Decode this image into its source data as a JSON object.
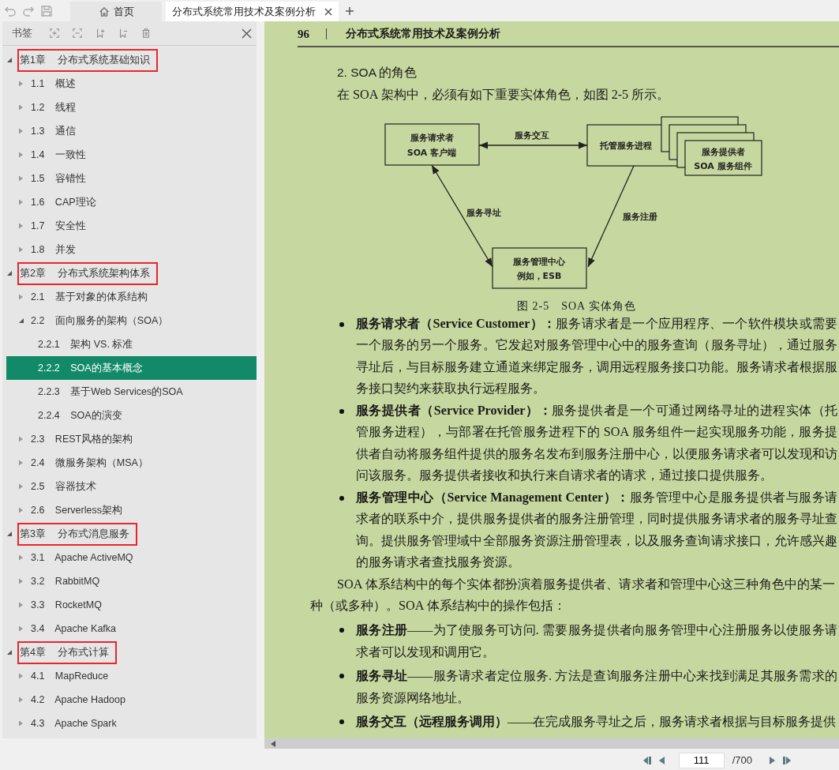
{
  "tabs": [
    {
      "label": "首页",
      "kind": "home",
      "selected": false
    },
    {
      "label": "分布式系统常用技术及案例分析",
      "kind": "document",
      "selected": true
    }
  ],
  "sidebar": {
    "title": "书签",
    "items": [
      {
        "number": "第1章",
        "label": "分布式系统基础知识",
        "expanded": true,
        "marked": true,
        "selected": false,
        "children": [
          {
            "number": "1.1",
            "label": "概述",
            "expanded": false,
            "marked": false,
            "selected": false
          },
          {
            "number": "1.2",
            "label": "线程",
            "expanded": false,
            "marked": false,
            "selected": false
          },
          {
            "number": "1.3",
            "label": "通信",
            "expanded": false,
            "marked": false,
            "selected": false
          },
          {
            "number": "1.4",
            "label": "一致性",
            "expanded": false,
            "marked": false,
            "selected": false
          },
          {
            "number": "1.5",
            "label": "容错性",
            "expanded": false,
            "marked": false,
            "selected": false
          },
          {
            "number": "1.6",
            "label": "CAP理论",
            "expanded": false,
            "marked": false,
            "selected": false
          },
          {
            "number": "1.7",
            "label": "安全性",
            "expanded": false,
            "marked": false,
            "selected": false
          },
          {
            "number": "1.8",
            "label": "并发",
            "expanded": false,
            "marked": false,
            "selected": false
          }
        ]
      },
      {
        "number": "第2章",
        "label": "分布式系统架构体系",
        "expanded": true,
        "marked": true,
        "selected": false,
        "children": [
          {
            "number": "2.1",
            "label": "基于对象的体系结构",
            "expanded": false,
            "marked": false,
            "selected": false
          },
          {
            "number": "2.2",
            "label": "面向服务的架构（SOA）",
            "expanded": true,
            "marked": false,
            "selected": false,
            "children": [
              {
                "number": "2.2.1",
                "label": "架构 VS. 标准",
                "marked": false,
                "selected": false
              },
              {
                "number": "2.2.2",
                "label": "SOA的基本概念",
                "marked": false,
                "selected": true
              },
              {
                "number": "2.2.3",
                "label": "基于Web Services的SOA",
                "marked": false,
                "selected": false
              },
              {
                "number": "2.2.4",
                "label": "SOA的演变",
                "marked": false,
                "selected": false
              }
            ]
          },
          {
            "number": "2.3",
            "label": "REST风格的架构",
            "expanded": false,
            "marked": false,
            "selected": false
          },
          {
            "number": "2.4",
            "label": "微服务架构（MSA）",
            "expanded": false,
            "marked": false,
            "selected": false
          },
          {
            "number": "2.5",
            "label": "容器技术",
            "expanded": false,
            "marked": false,
            "selected": false
          },
          {
            "number": "2.6",
            "label": "Serverless架构",
            "expanded": false,
            "marked": false,
            "selected": false
          }
        ]
      },
      {
        "number": "第3章",
        "label": "分布式消息服务",
        "expanded": true,
        "marked": true,
        "selected": false,
        "children": [
          {
            "number": "3.1",
            "label": "Apache ActiveMQ",
            "expanded": false,
            "marked": false,
            "selected": false
          },
          {
            "number": "3.2",
            "label": "RabbitMQ",
            "expanded": false,
            "marked": false,
            "selected": false
          },
          {
            "number": "3.3",
            "label": "RocketMQ",
            "expanded": false,
            "marked": false,
            "selected": false
          },
          {
            "number": "3.4",
            "label": "Apache Kafka",
            "expanded": false,
            "marked": false,
            "selected": false
          }
        ]
      },
      {
        "number": "第4章",
        "label": "分布式计算",
        "expanded": true,
        "marked": true,
        "selected": false,
        "children": [
          {
            "number": "4.1",
            "label": "MapReduce",
            "expanded": false,
            "marked": false,
            "selected": false
          },
          {
            "number": "4.2",
            "label": "Apache Hadoop",
            "expanded": false,
            "marked": false,
            "selected": false
          },
          {
            "number": "4.3",
            "label": "Apache Spark",
            "expanded": false,
            "marked": false,
            "selected": false
          }
        ]
      }
    ]
  },
  "page": {
    "page_number": "96",
    "running_title": "分布式系统常用技术及案例分析",
    "heading": "2. SOA 的角色",
    "intro": "在 SOA 架构中，必须有如下重要实体角色，如图 2-5 所示。",
    "figure": {
      "nodes": [
        {
          "kind": "requester",
          "lines": [
            "服务请求者",
            "SOA 客户端"
          ]
        },
        {
          "kind": "host",
          "lines": [
            "托管服务进程"
          ]
        },
        {
          "kind": "provider",
          "lines": [
            "服务提供者",
            "SOA 服务组件"
          ]
        },
        {
          "kind": "registry",
          "lines": [
            "服务管理中心",
            "例如，ESB"
          ]
        }
      ],
      "edges": [
        {
          "kind": "interact",
          "label": "服务交互"
        },
        {
          "kind": "discover",
          "label": "服务寻址"
        },
        {
          "kind": "register",
          "label": "服务注册"
        }
      ],
      "caption": "图 2-5　SOA 实体角色"
    },
    "roles": [
      "**服务请求者（Service Customer）：**服务请求者是一个应用程序、一个软件模块或需要一个服务的另一个服务。它发起对服务管理中心中的服务查询（服务寻址），通过服务寻址后，与目标服务建立通道来绑定服务，调用远程服务接口功能。服务请求者根据服务接口契约来获取执行远程服务。",
      "**服务提供者（Service Provider）：**服务提供者是一个可通过网络寻址的进程实体（托管服务进程），与部署在托管服务进程下的 SOA 服务组件一起实现服务功能，服务提供者自动将服务组件提供的服务名发布到服务注册中心，以便服务请求者可以发现和访问该服务。服务提供者接收和执行来自请求者的请求，通过接口提供服务。",
      "**服务管理中心（Service Management Center）：**服务管理中心是服务提供者与服务请求者的联系中介，提供服务提供者的服务注册管理，同时提供服务请求者的服务寻址查询。提供服务管理域中全部服务资源注册管理表，以及服务查询请求接口，允许感兴趣的服务请求者查找服务资源。"
    ],
    "paragraph": "SOA 体系结构中的每个实体都扮演着服务提供者、请求者和管理中心这三种角色中的某一种（或多种）。SOA 体系结构中的操作包括：",
    "operations": [
      "**服务注册**——为了使服务可访问. 需要服务提供者向服务管理中心注册服务以使服务请求者可以发现和调用它。",
      "**服务寻址**——服务请求者定位服务. 方法是查询服务注册中心来找到满足其服务需求的服务资源网络地址。",
      "**服务交互（远程服务调用）**——在完成服务寻址之后，服务请求者根据与目标服务提供"
    ]
  },
  "pager": {
    "current": "111",
    "total": "/700"
  }
}
